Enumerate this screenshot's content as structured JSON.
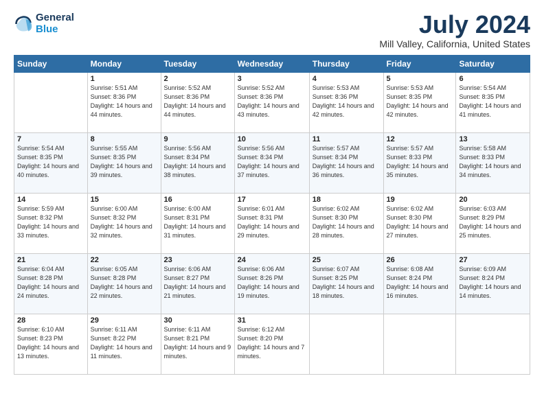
{
  "logo": {
    "line1": "General",
    "line2": "Blue"
  },
  "title": "July 2024",
  "subtitle": "Mill Valley, California, United States",
  "days_header": [
    "Sunday",
    "Monday",
    "Tuesday",
    "Wednesday",
    "Thursday",
    "Friday",
    "Saturday"
  ],
  "weeks": [
    [
      {
        "day": "",
        "sunrise": "",
        "sunset": "",
        "daylight": ""
      },
      {
        "day": "1",
        "sunrise": "Sunrise: 5:51 AM",
        "sunset": "Sunset: 8:36 PM",
        "daylight": "Daylight: 14 hours and 44 minutes."
      },
      {
        "day": "2",
        "sunrise": "Sunrise: 5:52 AM",
        "sunset": "Sunset: 8:36 PM",
        "daylight": "Daylight: 14 hours and 44 minutes."
      },
      {
        "day": "3",
        "sunrise": "Sunrise: 5:52 AM",
        "sunset": "Sunset: 8:36 PM",
        "daylight": "Daylight: 14 hours and 43 minutes."
      },
      {
        "day": "4",
        "sunrise": "Sunrise: 5:53 AM",
        "sunset": "Sunset: 8:36 PM",
        "daylight": "Daylight: 14 hours and 42 minutes."
      },
      {
        "day": "5",
        "sunrise": "Sunrise: 5:53 AM",
        "sunset": "Sunset: 8:35 PM",
        "daylight": "Daylight: 14 hours and 42 minutes."
      },
      {
        "day": "6",
        "sunrise": "Sunrise: 5:54 AM",
        "sunset": "Sunset: 8:35 PM",
        "daylight": "Daylight: 14 hours and 41 minutes."
      }
    ],
    [
      {
        "day": "7",
        "sunrise": "Sunrise: 5:54 AM",
        "sunset": "Sunset: 8:35 PM",
        "daylight": "Daylight: 14 hours and 40 minutes."
      },
      {
        "day": "8",
        "sunrise": "Sunrise: 5:55 AM",
        "sunset": "Sunset: 8:35 PM",
        "daylight": "Daylight: 14 hours and 39 minutes."
      },
      {
        "day": "9",
        "sunrise": "Sunrise: 5:56 AM",
        "sunset": "Sunset: 8:34 PM",
        "daylight": "Daylight: 14 hours and 38 minutes."
      },
      {
        "day": "10",
        "sunrise": "Sunrise: 5:56 AM",
        "sunset": "Sunset: 8:34 PM",
        "daylight": "Daylight: 14 hours and 37 minutes."
      },
      {
        "day": "11",
        "sunrise": "Sunrise: 5:57 AM",
        "sunset": "Sunset: 8:34 PM",
        "daylight": "Daylight: 14 hours and 36 minutes."
      },
      {
        "day": "12",
        "sunrise": "Sunrise: 5:57 AM",
        "sunset": "Sunset: 8:33 PM",
        "daylight": "Daylight: 14 hours and 35 minutes."
      },
      {
        "day": "13",
        "sunrise": "Sunrise: 5:58 AM",
        "sunset": "Sunset: 8:33 PM",
        "daylight": "Daylight: 14 hours and 34 minutes."
      }
    ],
    [
      {
        "day": "14",
        "sunrise": "Sunrise: 5:59 AM",
        "sunset": "Sunset: 8:32 PM",
        "daylight": "Daylight: 14 hours and 33 minutes."
      },
      {
        "day": "15",
        "sunrise": "Sunrise: 6:00 AM",
        "sunset": "Sunset: 8:32 PM",
        "daylight": "Daylight: 14 hours and 32 minutes."
      },
      {
        "day": "16",
        "sunrise": "Sunrise: 6:00 AM",
        "sunset": "Sunset: 8:31 PM",
        "daylight": "Daylight: 14 hours and 31 minutes."
      },
      {
        "day": "17",
        "sunrise": "Sunrise: 6:01 AM",
        "sunset": "Sunset: 8:31 PM",
        "daylight": "Daylight: 14 hours and 29 minutes."
      },
      {
        "day": "18",
        "sunrise": "Sunrise: 6:02 AM",
        "sunset": "Sunset: 8:30 PM",
        "daylight": "Daylight: 14 hours and 28 minutes."
      },
      {
        "day": "19",
        "sunrise": "Sunrise: 6:02 AM",
        "sunset": "Sunset: 8:30 PM",
        "daylight": "Daylight: 14 hours and 27 minutes."
      },
      {
        "day": "20",
        "sunrise": "Sunrise: 6:03 AM",
        "sunset": "Sunset: 8:29 PM",
        "daylight": "Daylight: 14 hours and 25 minutes."
      }
    ],
    [
      {
        "day": "21",
        "sunrise": "Sunrise: 6:04 AM",
        "sunset": "Sunset: 8:28 PM",
        "daylight": "Daylight: 14 hours and 24 minutes."
      },
      {
        "day": "22",
        "sunrise": "Sunrise: 6:05 AM",
        "sunset": "Sunset: 8:28 PM",
        "daylight": "Daylight: 14 hours and 22 minutes."
      },
      {
        "day": "23",
        "sunrise": "Sunrise: 6:06 AM",
        "sunset": "Sunset: 8:27 PM",
        "daylight": "Daylight: 14 hours and 21 minutes."
      },
      {
        "day": "24",
        "sunrise": "Sunrise: 6:06 AM",
        "sunset": "Sunset: 8:26 PM",
        "daylight": "Daylight: 14 hours and 19 minutes."
      },
      {
        "day": "25",
        "sunrise": "Sunrise: 6:07 AM",
        "sunset": "Sunset: 8:25 PM",
        "daylight": "Daylight: 14 hours and 18 minutes."
      },
      {
        "day": "26",
        "sunrise": "Sunrise: 6:08 AM",
        "sunset": "Sunset: 8:24 PM",
        "daylight": "Daylight: 14 hours and 16 minutes."
      },
      {
        "day": "27",
        "sunrise": "Sunrise: 6:09 AM",
        "sunset": "Sunset: 8:24 PM",
        "daylight": "Daylight: 14 hours and 14 minutes."
      }
    ],
    [
      {
        "day": "28",
        "sunrise": "Sunrise: 6:10 AM",
        "sunset": "Sunset: 8:23 PM",
        "daylight": "Daylight: 14 hours and 13 minutes."
      },
      {
        "day": "29",
        "sunrise": "Sunrise: 6:11 AM",
        "sunset": "Sunset: 8:22 PM",
        "daylight": "Daylight: 14 hours and 11 minutes."
      },
      {
        "day": "30",
        "sunrise": "Sunrise: 6:11 AM",
        "sunset": "Sunset: 8:21 PM",
        "daylight": "Daylight: 14 hours and 9 minutes."
      },
      {
        "day": "31",
        "sunrise": "Sunrise: 6:12 AM",
        "sunset": "Sunset: 8:20 PM",
        "daylight": "Daylight: 14 hours and 7 minutes."
      },
      {
        "day": "",
        "sunrise": "",
        "sunset": "",
        "daylight": ""
      },
      {
        "day": "",
        "sunrise": "",
        "sunset": "",
        "daylight": ""
      },
      {
        "day": "",
        "sunrise": "",
        "sunset": "",
        "daylight": ""
      }
    ]
  ]
}
